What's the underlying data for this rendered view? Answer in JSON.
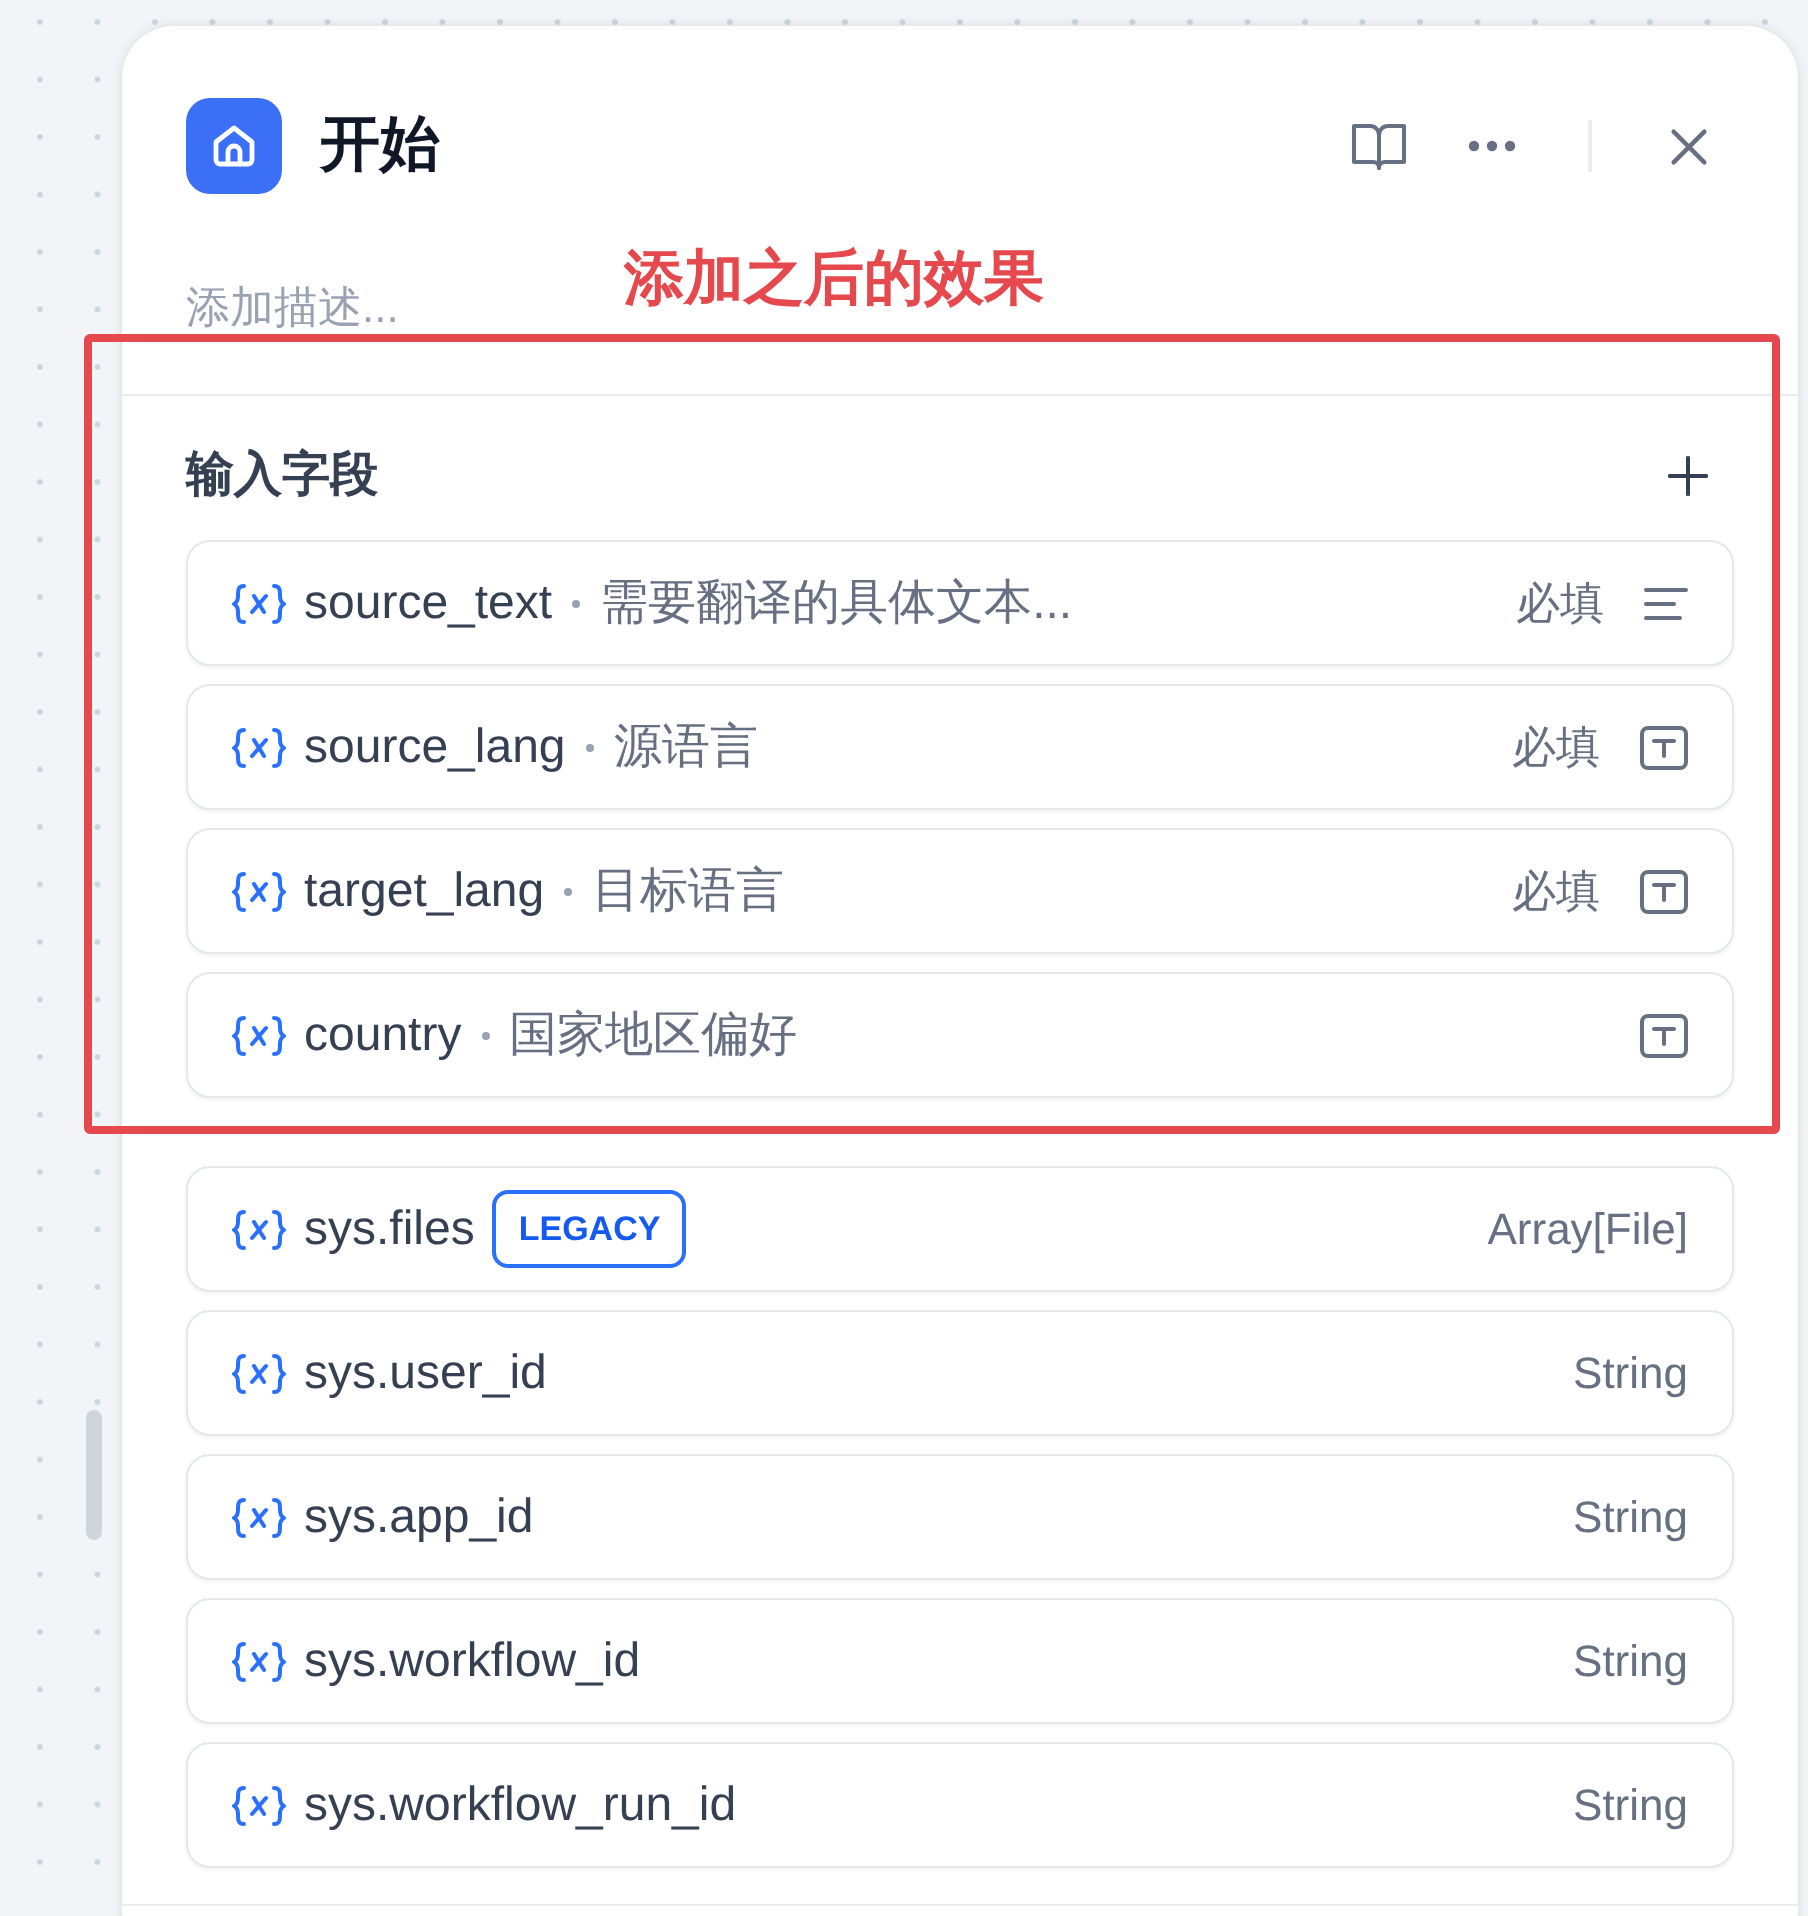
{
  "node_panel": {
    "title": "开始",
    "description_field": {
      "placeholder": "添加描述..."
    }
  },
  "annotation": {
    "text": "添加之后的效果"
  },
  "input_fields": {
    "heading": "输入字段",
    "items": [
      {
        "name": "source_text",
        "description": "需要翻译的具体文本...",
        "required_label": "必填",
        "kind": "paragraph"
      },
      {
        "name": "source_lang",
        "description": "源语言",
        "required_label": "必填",
        "kind": "text-input"
      },
      {
        "name": "target_lang",
        "description": "目标语言",
        "required_label": "必填",
        "kind": "text-input"
      },
      {
        "name": "country",
        "description": "国家地区偏好",
        "kind": "text-input"
      }
    ]
  },
  "system_variables": [
    {
      "name": "sys.files",
      "badge": "LEGACY",
      "type": "Array[File]"
    },
    {
      "name": "sys.user_id",
      "type": "String"
    },
    {
      "name": "sys.app_id",
      "type": "String"
    },
    {
      "name": "sys.workflow_id",
      "type": "String"
    },
    {
      "name": "sys.workflow_run_id",
      "type": "String"
    }
  ]
}
